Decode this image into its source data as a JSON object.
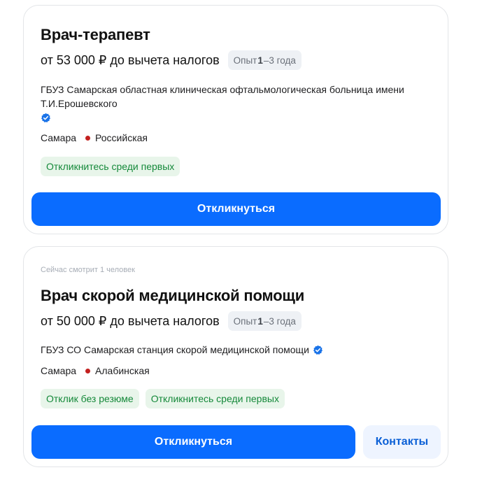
{
  "vacancies": [
    {
      "title": "Врач-терапевт",
      "salary": "от 53 000 ₽ до вычета налогов",
      "experience": {
        "prefix": "Опыт ",
        "value": "1",
        "suffix": "–3 года"
      },
      "company": "ГБУЗ Самарская областная клиническая офтальмологическая больница имени Т.И.Ерошевского",
      "verified_icon": "verified-check-icon",
      "city": "Самара",
      "metro": "Российская",
      "tags": [
        "Откликнитесь среди первых"
      ],
      "respond_label": "Откликнуться"
    },
    {
      "viewers": "Сейчас смотрит 1 человек",
      "title": "Врач скорой медицинской помощи",
      "salary": "от 50 000 ₽ до вычета налогов",
      "experience": {
        "prefix": "Опыт ",
        "value": "1",
        "suffix": "–3 года"
      },
      "company": "ГБУЗ СО Самарская станция скорой медицинской помощи",
      "verified_icon": "verified-check-icon",
      "city": "Самара",
      "metro": "Алабинская",
      "tags": [
        "Отклик без резюме",
        "Откликнитесь среди первых"
      ],
      "respond_label": "Откликнуться",
      "contacts_label": "Контакты"
    }
  ],
  "colors": {
    "primary_button": "#0a6cff",
    "secondary_button_bg": "#eef4ff",
    "tag_bg": "#e8f5ea",
    "tag_text": "#15893a",
    "metro_dot": "#c3201f",
    "verified": "#1a73e8"
  }
}
